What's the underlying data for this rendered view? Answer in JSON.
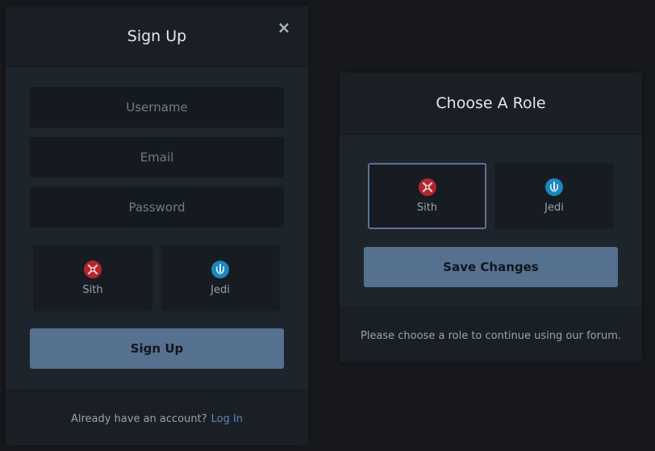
{
  "signup": {
    "title": "Sign Up",
    "close_label": "×",
    "username_placeholder": "Username",
    "email_placeholder": "Email",
    "password_placeholder": "Password",
    "roles": [
      {
        "label": "Sith",
        "icon": "sith-emblem-icon",
        "color": "#b3262b"
      },
      {
        "label": "Jedi",
        "icon": "jedi-emblem-icon",
        "color": "#1d86bd"
      }
    ],
    "submit_label": "Sign Up",
    "footer_text": "Already have an account?",
    "footer_link": "Log In"
  },
  "role_dialog": {
    "title": "Choose A Role",
    "roles": [
      {
        "label": "Sith",
        "icon": "sith-emblem-icon",
        "selected": true
      },
      {
        "label": "Jedi",
        "icon": "jedi-emblem-icon",
        "selected": false
      }
    ],
    "save_label": "Save Changes",
    "footer_text": "Please choose a role to continue using our forum."
  },
  "colors": {
    "background": "#17191d",
    "panel": "#1e242c",
    "button": "#56708f",
    "link": "#5d86b8",
    "selected_border": "#5a7394"
  }
}
